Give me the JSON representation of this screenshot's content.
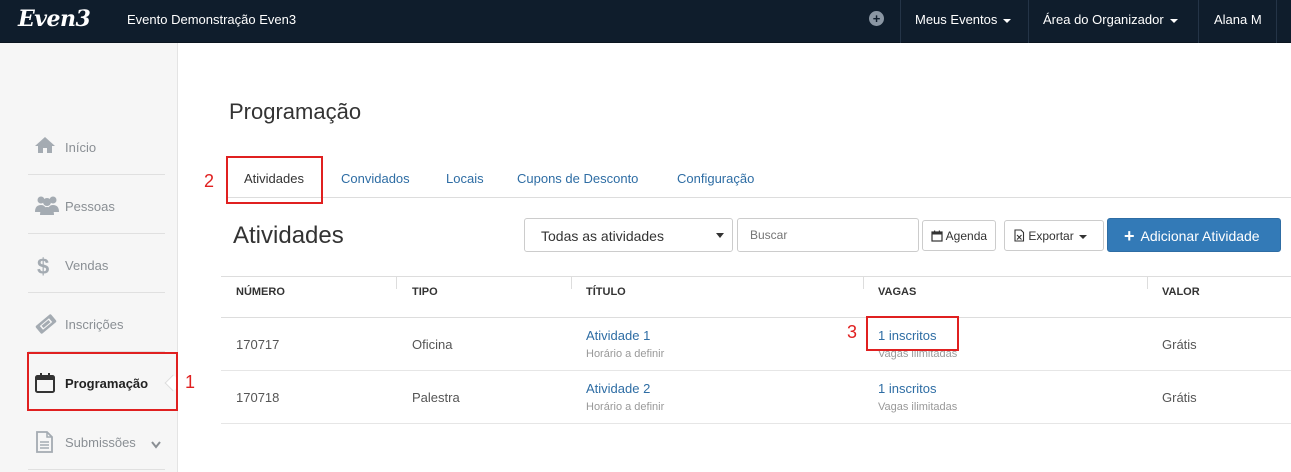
{
  "navbar": {
    "logo": "Even3",
    "event_name": "Evento Demonstração Even3",
    "items": [
      {
        "label": "Meus Eventos"
      },
      {
        "label": "Área do Organizador"
      },
      {
        "label": "Alana M"
      }
    ]
  },
  "sidebar": {
    "items": [
      {
        "label": "Início",
        "icon": "home-icon"
      },
      {
        "label": "Pessoas",
        "icon": "users-icon"
      },
      {
        "label": "Vendas",
        "icon": "dollar-icon"
      },
      {
        "label": "Inscrições",
        "icon": "ticket-icon"
      },
      {
        "label": "Programação",
        "icon": "calendar-icon",
        "active": true
      },
      {
        "label": "Submissões",
        "icon": "document-icon"
      }
    ]
  },
  "page": {
    "title": "Programação",
    "tabs": [
      {
        "label": "Atividades",
        "active": true
      },
      {
        "label": "Convidados"
      },
      {
        "label": "Locais"
      },
      {
        "label": "Cupons de Desconto"
      },
      {
        "label": "Configuração"
      }
    ],
    "section_title": "Atividades",
    "filter": {
      "selected": "Todas as atividades"
    },
    "search": {
      "placeholder": "Buscar"
    },
    "agenda_label": "Agenda",
    "export_label": "Exportar",
    "add_label": "Adicionar Atividade"
  },
  "table": {
    "columns": [
      "NÚMERO",
      "TIPO",
      "TÍTULO",
      "VAGAS",
      "VALOR"
    ],
    "rows": [
      {
        "numero": "170717",
        "tipo": "Oficina",
        "titulo": "Atividade 1",
        "horario": "Horário a definir",
        "inscritos": "1 inscritos",
        "vagas": "Vagas ilimitadas",
        "valor": "Grátis"
      },
      {
        "numero": "170718",
        "tipo": "Palestra",
        "titulo": "Atividade 2",
        "horario": "Horário a definir",
        "inscritos": "1 inscritos",
        "vagas": "Vagas ilimitadas",
        "valor": "Grátis"
      }
    ]
  },
  "annotations": [
    "1",
    "2",
    "3"
  ],
  "colors": {
    "navbar": "#0f1d2c",
    "primary": "#337ab7",
    "link": "#2e6da4",
    "annotation": "#e02020"
  }
}
